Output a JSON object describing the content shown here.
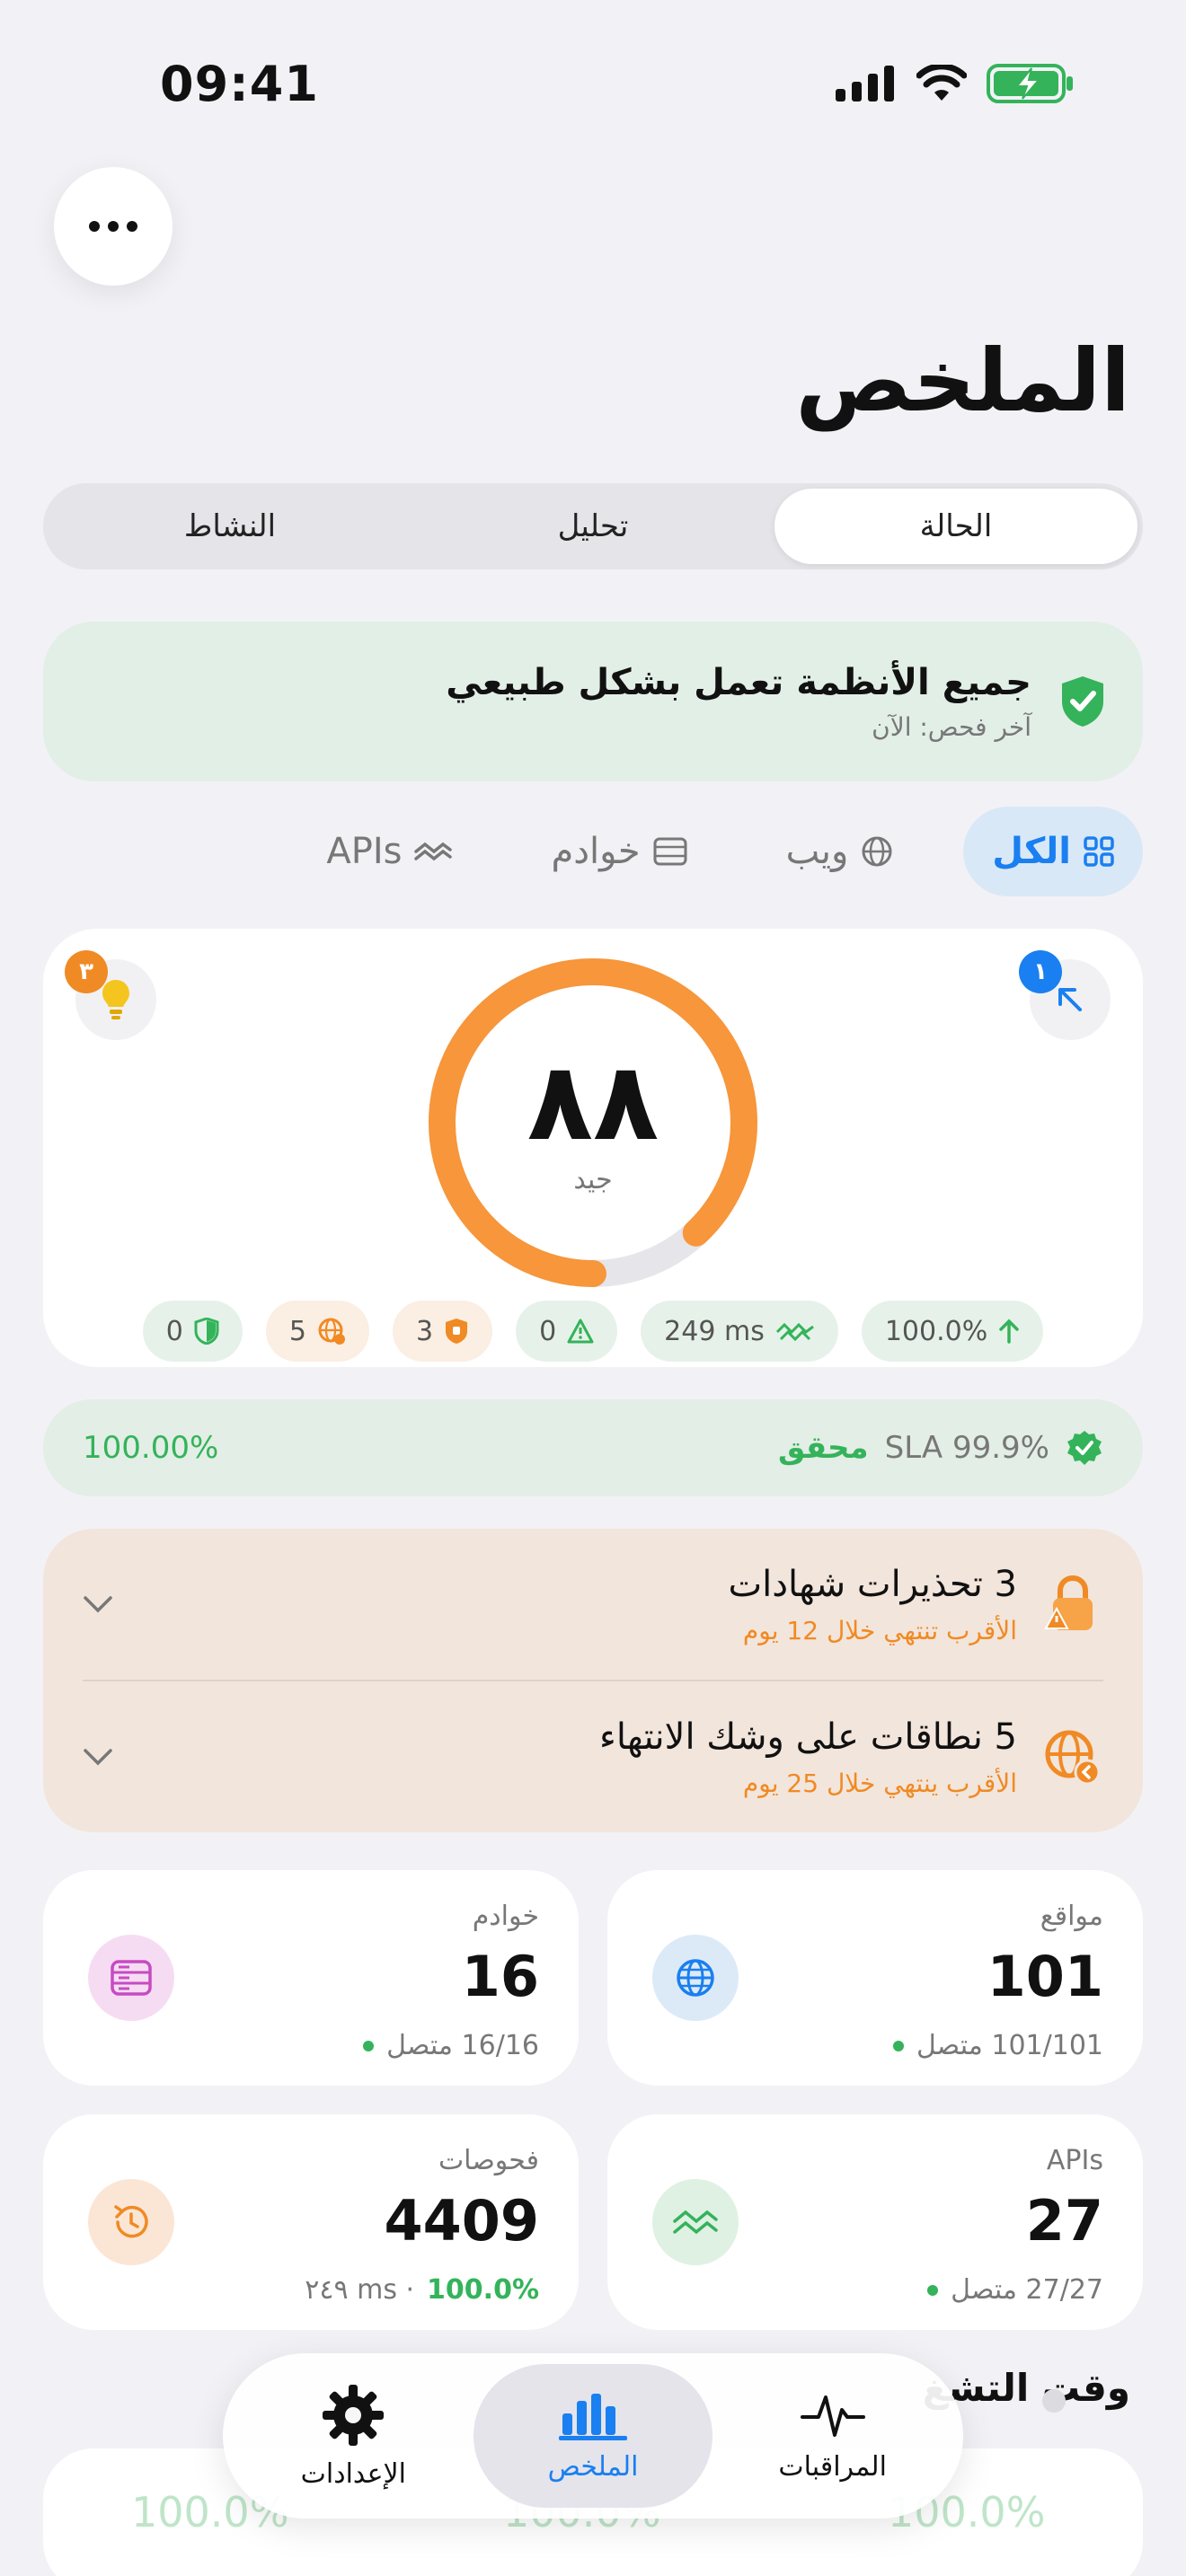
{
  "status_bar": {
    "time": "09:41"
  },
  "header": {
    "title": "الملخص"
  },
  "segments": [
    {
      "label": "الحالة",
      "active": true
    },
    {
      "label": "تحليل",
      "active": false
    },
    {
      "label": "النشاط",
      "active": false
    }
  ],
  "banner": {
    "title": "جميع الأنظمة تعمل بشكل طبيعي",
    "subtitle": "آخر فحص: الآن"
  },
  "filters": [
    {
      "label": "الكل",
      "icon": "grid-icon",
      "active": true
    },
    {
      "label": "ويب",
      "icon": "globe-icon",
      "active": false
    },
    {
      "label": "خوادم",
      "icon": "server-icon",
      "active": false
    },
    {
      "label": "APIs",
      "icon": "api-wave-icon",
      "active": false
    }
  ],
  "score": {
    "value": "٨٨",
    "label": "جيد",
    "fraction": 0.88,
    "left_badge": "٣",
    "right_badge": "١",
    "chips": [
      {
        "text": "100.0%",
        "icon": "arrow-up-icon",
        "tone": "green"
      },
      {
        "text": "249 ms",
        "icon": "speed-icon",
        "tone": "green"
      },
      {
        "text": "0",
        "icon": "warning-icon",
        "tone": "green"
      },
      {
        "text": "3",
        "icon": "shield-cert-icon",
        "tone": "orange"
      },
      {
        "text": "5",
        "icon": "globe-domain-icon",
        "tone": "orange"
      },
      {
        "text": "0",
        "icon": "shield-icon",
        "tone": "green"
      }
    ]
  },
  "sla": {
    "label": "SLA 99.9%",
    "status": "محقق",
    "value": "100.00%"
  },
  "warnings": [
    {
      "title": "3 تحذيرات شهادات",
      "subtitle": "الأقرب تنتهي خلال 12 يوم"
    },
    {
      "title": "5 نطاقات على وشك الانتهاء",
      "subtitle": "الأقرب ينتهي خلال 25 يوم"
    }
  ],
  "stats": {
    "websites": {
      "label": "مواقع",
      "value": "101",
      "sub": "101/101 متصل"
    },
    "servers": {
      "label": "خوادم",
      "value": "16",
      "sub": "16/16 متصل"
    },
    "apis": {
      "label": "APIs",
      "value": "27",
      "sub": "27/27 متصل"
    },
    "checks": {
      "label": "فحوصات",
      "value": "4409",
      "sub_pct": "100.0%",
      "sub_ms": "٢٤٩ ms ·"
    }
  },
  "uptime_section": {
    "title": "وقت التشغ"
  },
  "uptime_faded": [
    "100.0%",
    "100.0%",
    "100.0%"
  ],
  "tabbar": [
    {
      "label": "المراقبات",
      "icon": "heartbeat-icon",
      "active": false
    },
    {
      "label": "الملخص",
      "icon": "bar-chart-icon",
      "active": true
    },
    {
      "label": "الإعدادات",
      "icon": "gear-icon",
      "active": false
    }
  ],
  "colors": {
    "accent": "#1a7ff0",
    "success": "#34b35a",
    "warning": "#f08a24",
    "gauge": "#f7963a"
  }
}
